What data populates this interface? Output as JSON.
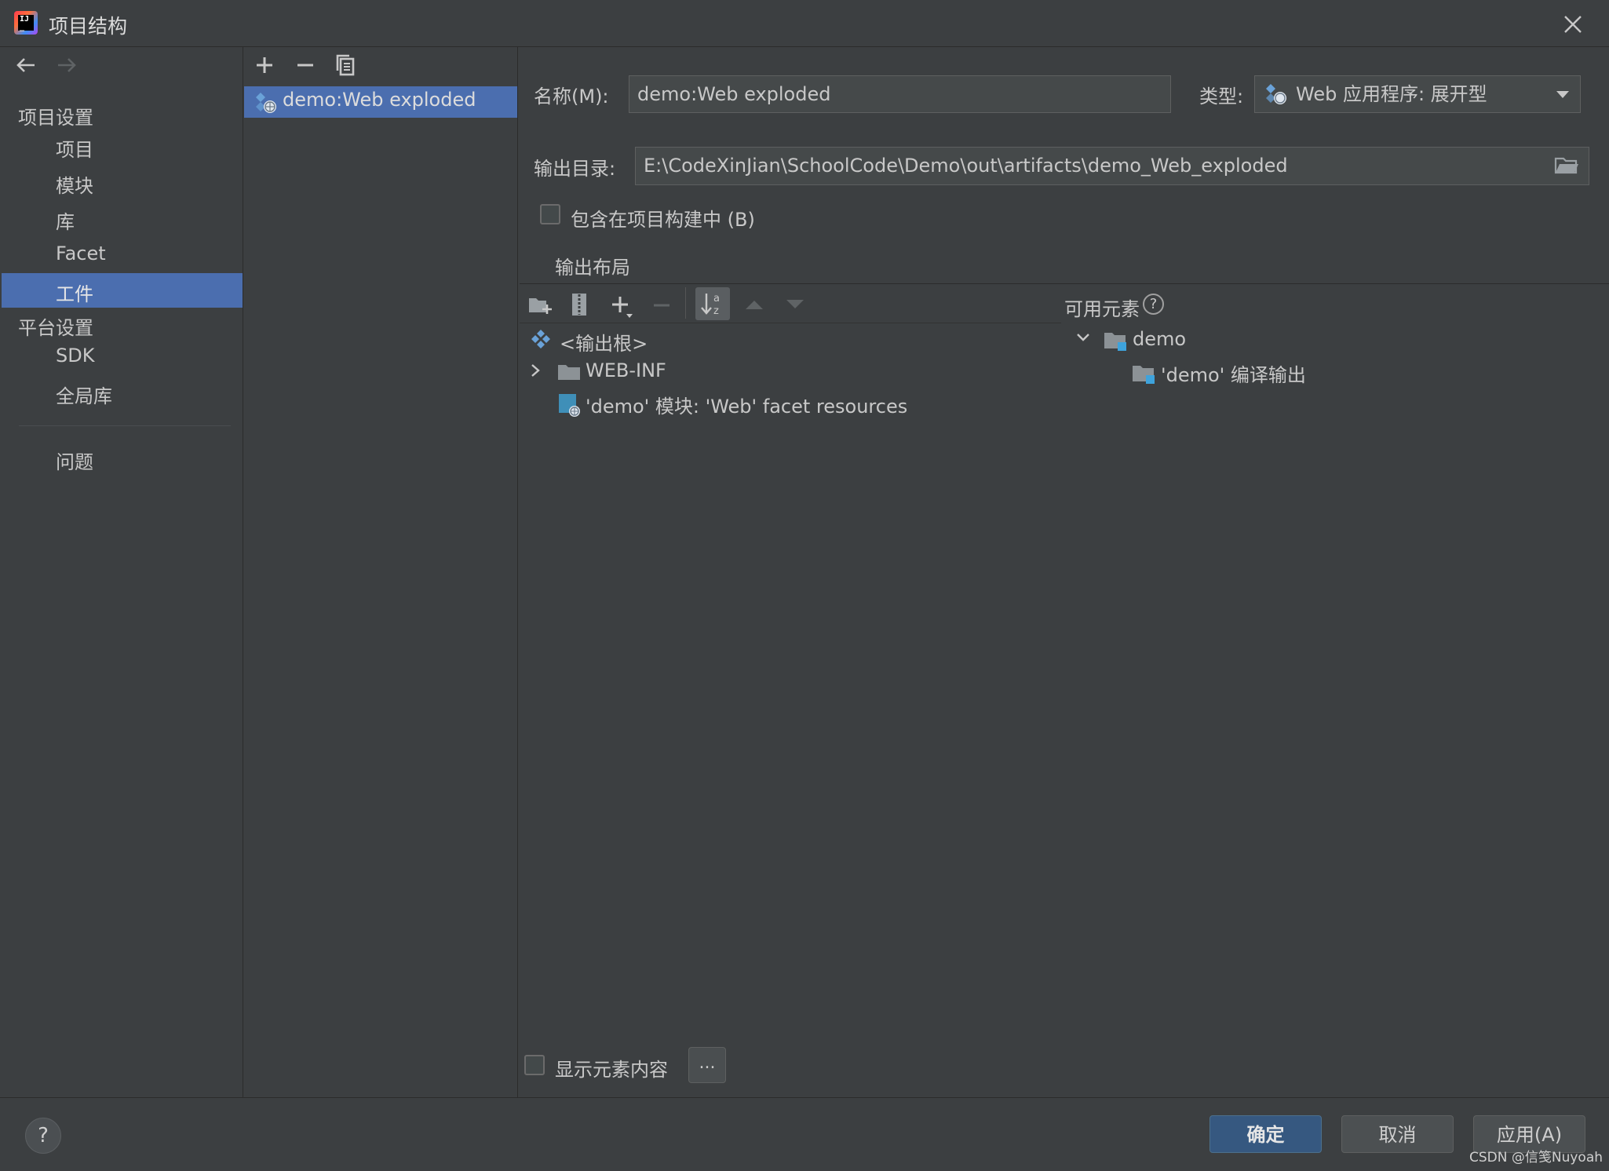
{
  "window": {
    "title": "项目结构",
    "icon": "intellij-idea-icon"
  },
  "nav": {
    "back_icon": "←",
    "forward_icon": "→",
    "project_settings": "项目设置",
    "project": "项目",
    "modules": "模块",
    "libraries": "库",
    "facets": "Facet",
    "artifacts": "工件",
    "platform_settings": "平台设置",
    "sdk": "SDK",
    "global_libraries": "全局库",
    "problems": "问题"
  },
  "artifacts_list": {
    "toolbar": {
      "add": "+",
      "remove": "−",
      "copy": "⧉"
    },
    "items": [
      "demo:Web exploded"
    ]
  },
  "artifact": {
    "name_label": "名称(M):",
    "name_value": "demo:Web exploded",
    "type_label": "类型:",
    "type_value": "Web 应用程序: 展开型",
    "output_dir_label": "输出目录:",
    "output_dir_value": "E:\\CodeXinJian\\SchoolCode\\Demo\\out\\artifacts\\demo_Web_exploded",
    "include_in_build": "包含在项目构建中 (B)",
    "include_checked": false,
    "output_layout_label": "输出布局",
    "available_elements_label": "可用元素",
    "help_icon": "?",
    "layout_tree": {
      "root": "<输出根>",
      "webinf": "WEB-INF",
      "facet_resources": "'demo' 模块: 'Web' facet resources"
    },
    "available_tree": {
      "demo": "demo",
      "compile_output": "'demo' 编译输出"
    },
    "show_contents": "显示元素内容",
    "show_checked": false,
    "dots_button": "..."
  },
  "footer": {
    "help": "?",
    "ok": "确定",
    "cancel": "取消",
    "apply": "应用(A)"
  },
  "watermark": "CSDN @信笺Nuyoah",
  "colors": {
    "background": "#3c3f41",
    "selection": "#4b6eaf",
    "primary_button": "#365880",
    "field": "#45494a"
  }
}
